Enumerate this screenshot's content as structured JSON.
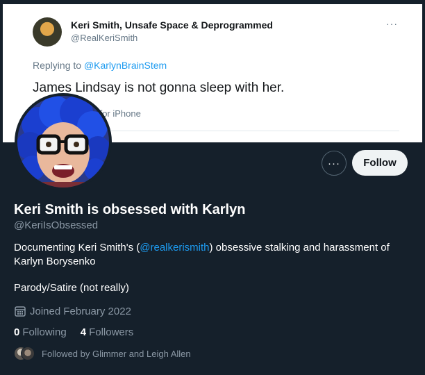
{
  "banner_tweet": {
    "author_name": "Keri Smith, Unsafe Space & Deprogrammed",
    "author_handle": "@RealKeriSmith",
    "more": "···",
    "replying_prefix": "Replying to ",
    "replying_mention": "@KarlynBrainStem",
    "text": "James Lindsay is not gonna sleep with her.",
    "meta": "6, 2022 · Twitter for iPhone"
  },
  "actions": {
    "more": "···",
    "follow": "Follow"
  },
  "profile": {
    "display_name": "Keri Smith is obsessed with Karlyn",
    "handle": "@KeriIsObsessed",
    "bio_before": "Documenting Keri Smith's (",
    "bio_mention": "@realkerismith",
    "bio_after": ") obsessive stalking and harassment of Karlyn Borysenko",
    "bio_line2": "Parody/Satire (not really)",
    "joined": "Joined February 2022",
    "icons": {
      "joined": "calendar-icon",
      "more": "more-horizontal-icon"
    }
  },
  "stats": {
    "following_count": "0",
    "following_label": "Following",
    "followers_count": "4",
    "followers_label": "Followers"
  },
  "followed_by": "Followed by Glimmer and Leigh Allen",
  "colors": {
    "background": "#15202b",
    "accent": "#1d9bf0",
    "secondary_text": "#8b98a5",
    "follow_button_bg": "#eff3f4"
  }
}
